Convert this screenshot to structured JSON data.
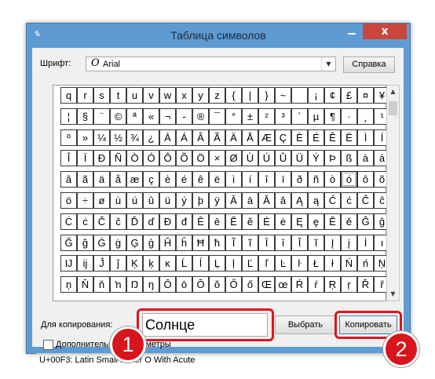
{
  "window": {
    "title": "Таблица символов",
    "close_label": "x"
  },
  "toolbar": {
    "font_label": "Шрифт:",
    "font_value": "Arial",
    "font_icon": "0",
    "help_label": "Справка"
  },
  "grid": {
    "rows": [
      [
        "q",
        "r",
        "s",
        "t",
        "u",
        "v",
        "w",
        "x",
        "y",
        "z",
        "{",
        "|",
        "}",
        "~",
        " ",
        "¡",
        "¢",
        "£",
        "¤",
        "¥"
      ],
      [
        "¦",
        "§",
        "¨",
        "©",
        "ª",
        "«",
        "¬",
        "-",
        "®",
        "¯",
        "°",
        "±",
        "²",
        "³",
        "´",
        "µ",
        "¶",
        "·",
        "¸",
        "¹"
      ],
      [
        "º",
        "»",
        "¼",
        "½",
        "¾",
        "¿",
        "À",
        "Á",
        "Â",
        "Ã",
        "Ä",
        "Å",
        "Æ",
        "Ç",
        "È",
        "É",
        "Ê",
        "Ë",
        "Ì",
        "Í"
      ],
      [
        "Î",
        "Ï",
        "Ð",
        "Ñ",
        "Ò",
        "Ó",
        "Ô",
        "Õ",
        "Ö",
        "×",
        "Ø",
        "Ù",
        "Ú",
        "Û",
        "Ü",
        "Ý",
        "Þ",
        "ß",
        "à",
        "á"
      ],
      [
        "â",
        "ã",
        "ä",
        "å",
        "æ",
        "ç",
        "è",
        "é",
        "ê",
        "ë",
        "ì",
        "í",
        "î",
        "ï",
        "ð",
        "ñ",
        "ò",
        "ó",
        "ô",
        "õ"
      ],
      [
        "ö",
        "÷",
        "ø",
        "ù",
        "ú",
        "û",
        "ü",
        "ý",
        "þ",
        "ÿ",
        "Ā",
        "ā",
        "Ă",
        "ă",
        "Ą",
        "ą",
        "Ć",
        "ć",
        "Ĉ",
        "ĉ"
      ],
      [
        "Ċ",
        "ċ",
        "Č",
        "č",
        "Ď",
        "ď",
        "Đ",
        "đ",
        "Ē",
        "ē",
        "Ĕ",
        "ĕ",
        "Ė",
        "ė",
        "Ę",
        "ę",
        "Ě",
        "ě",
        "Ĝ",
        "ĝ"
      ],
      [
        "Ğ",
        "ğ",
        "Ġ",
        "ġ",
        "Ģ",
        "ģ",
        "Ĥ",
        "ĥ",
        "Ħ",
        "ħ",
        "Ĩ",
        "ĩ",
        "Ī",
        "ī",
        "Ĭ",
        "ĭ",
        "Į",
        "į",
        "İ",
        "ı"
      ],
      [
        "Ĳ",
        "ĳ",
        "Ĵ",
        "ĵ",
        "Ķ",
        "ķ",
        "ĸ",
        "Ĺ",
        "ĺ",
        "Ļ",
        "ļ",
        "Ľ",
        "ľ",
        "Ŀ",
        "ŀ",
        "Ł",
        "ł",
        "Ń",
        "ń",
        "Ņ"
      ],
      [
        "ņ",
        "Ň",
        "ň",
        "ŉ",
        "Ŋ",
        "ŋ",
        "Ō",
        "ō",
        "Ŏ",
        "ŏ",
        "Ő",
        "ő",
        "Œ",
        "œ",
        "Ŕ",
        "ŕ",
        "Ŗ",
        "ŗ",
        "Ř",
        "ř"
      ]
    ],
    "selected_symbol": "ó"
  },
  "copy": {
    "label": "Для копирования:",
    "value": "Солнце",
    "select_label": "Выбрать",
    "copy_label": "Копировать"
  },
  "advanced": {
    "label": "Дополнительные параметры"
  },
  "status": {
    "text": "U+00F3: Latin Small Letter O With Acute"
  },
  "annotations": {
    "badge1": "1",
    "badge2": "2"
  },
  "colors": {
    "highlight": "#e0141d",
    "titlebar": "#5e9bd3",
    "close": "#c9463d"
  }
}
